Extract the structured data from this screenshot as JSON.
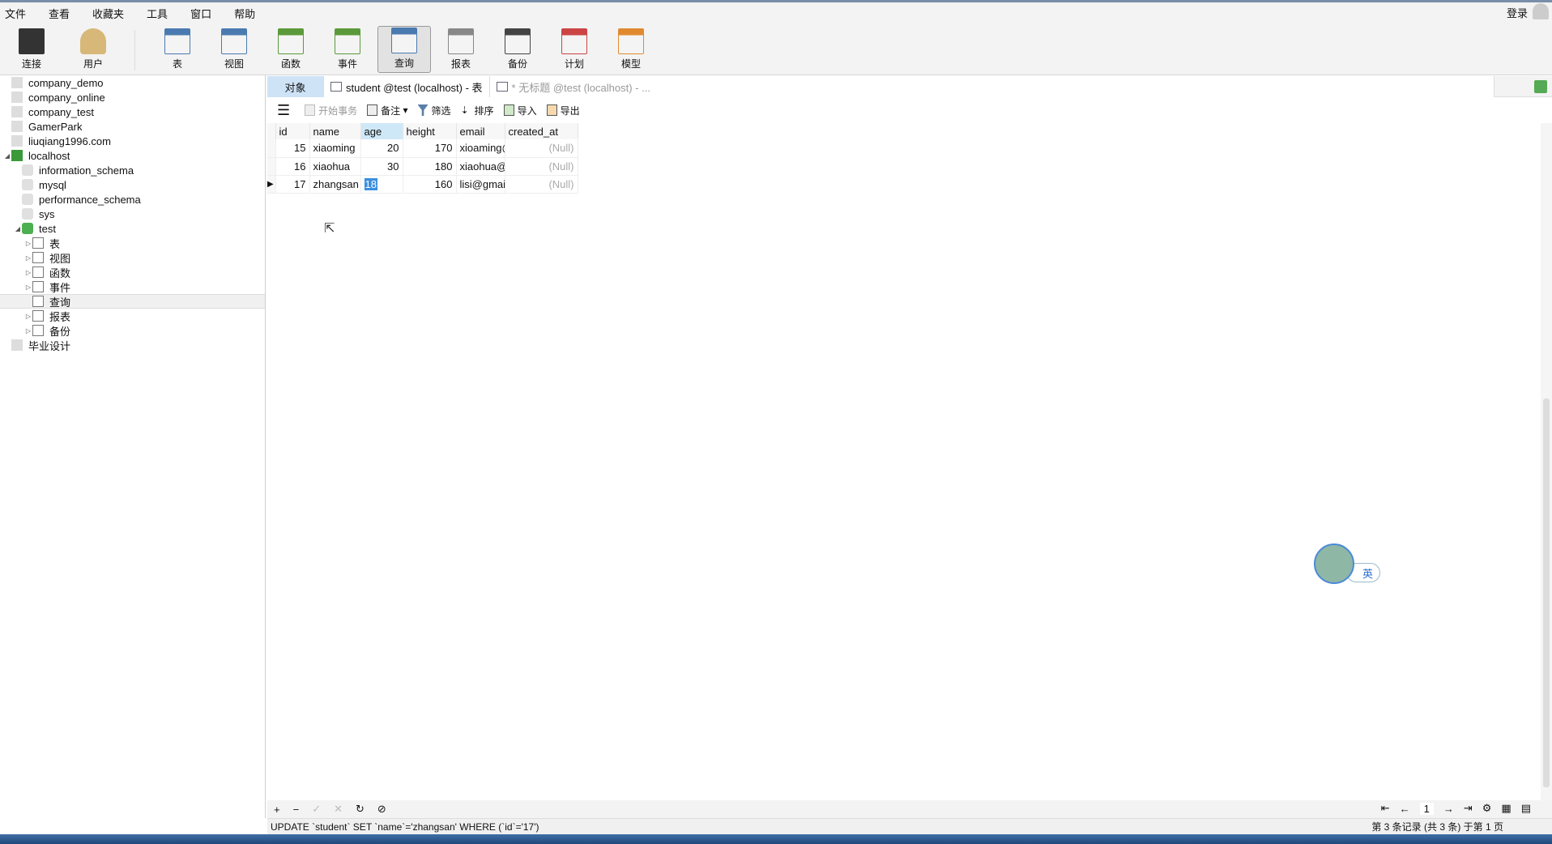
{
  "menu": [
    "文件",
    "查看",
    "收藏夹",
    "工具",
    "窗口",
    "帮助"
  ],
  "login": "登录",
  "toolbar": [
    {
      "label": "连接",
      "icon": "connection-icon",
      "color": "#333333"
    },
    {
      "label": "用户",
      "icon": "user-icon",
      "color": "#d8b878"
    },
    {
      "label": "表",
      "icon": "table-icon",
      "color": "#4a7ab0"
    },
    {
      "label": "视图",
      "icon": "view-icon",
      "color": "#4a7ab0"
    },
    {
      "label": "函数",
      "icon": "function-icon",
      "color": "#5a9a3a"
    },
    {
      "label": "事件",
      "icon": "event-icon",
      "color": "#5a9a3a"
    },
    {
      "label": "查询",
      "icon": "query-icon",
      "color": "#4a7ab0",
      "active": true
    },
    {
      "label": "报表",
      "icon": "report-icon",
      "color": "#888888"
    },
    {
      "label": "备份",
      "icon": "backup-icon",
      "color": "#444444"
    },
    {
      "label": "计划",
      "icon": "schedule-icon",
      "color": "#cc4444"
    },
    {
      "label": "模型",
      "icon": "model-icon",
      "color": "#e08a30"
    }
  ],
  "tree": [
    {
      "label": "company_demo",
      "level": 0,
      "type": "conn"
    },
    {
      "label": "company_online",
      "level": 0,
      "type": "conn"
    },
    {
      "label": "company_test",
      "level": 0,
      "type": "conn"
    },
    {
      "label": "GamerPark",
      "level": 0,
      "type": "conn"
    },
    {
      "label": "liuqiang1996.com",
      "level": 0,
      "type": "conn"
    },
    {
      "label": "localhost",
      "level": 0,
      "type": "conn-on",
      "expanded": true
    },
    {
      "label": "information_schema",
      "level": 1,
      "type": "db"
    },
    {
      "label": "mysql",
      "level": 1,
      "type": "db"
    },
    {
      "label": "performance_schema",
      "level": 1,
      "type": "db"
    },
    {
      "label": "sys",
      "level": 1,
      "type": "db"
    },
    {
      "label": "test",
      "level": 1,
      "type": "db-on",
      "expanded": true
    },
    {
      "label": "表",
      "level": 2,
      "type": "sub",
      "collapsed": true
    },
    {
      "label": "视图",
      "level": 2,
      "type": "sub",
      "collapsed": true
    },
    {
      "label": "函数",
      "level": 2,
      "type": "sub",
      "collapsed": true
    },
    {
      "label": "事件",
      "level": 2,
      "type": "sub",
      "collapsed": true
    },
    {
      "label": "查询",
      "level": 2,
      "type": "sub",
      "selected": true
    },
    {
      "label": "报表",
      "level": 2,
      "type": "sub",
      "collapsed": true
    },
    {
      "label": "备份",
      "level": 2,
      "type": "sub",
      "collapsed": true
    },
    {
      "label": "毕业设计",
      "level": 0,
      "type": "conn"
    }
  ],
  "tabs": {
    "objects": "对象",
    "current": "student @test (localhost) - 表",
    "other": "* 无标题 @test (localhost) - ..."
  },
  "gridbar": {
    "begin_tx": "开始事务",
    "memo": "备注",
    "filter": "筛选",
    "sort": "排序",
    "import": "导入",
    "export": "导出"
  },
  "grid": {
    "columns": [
      "id",
      "name",
      "age",
      "height",
      "email",
      "created_at"
    ],
    "rows": [
      [
        "15",
        "xiaoming",
        "20",
        "170",
        "xioaming@",
        "(Null)"
      ],
      [
        "16",
        "xiaohua",
        "30",
        "180",
        "xiaohua@",
        "(Null)"
      ],
      [
        "17",
        "zhangsan",
        "18",
        "160",
        "lisi@gmail",
        "(Null)"
      ]
    ]
  },
  "bottom": {
    "page": "1"
  },
  "status": {
    "sql": "UPDATE `student` SET `name`='zhangsan' WHERE (`id`='17')",
    "record": "第 3 条记录 (共 3 条) 于第 1 页"
  },
  "ime": {
    "lang": "英"
  }
}
